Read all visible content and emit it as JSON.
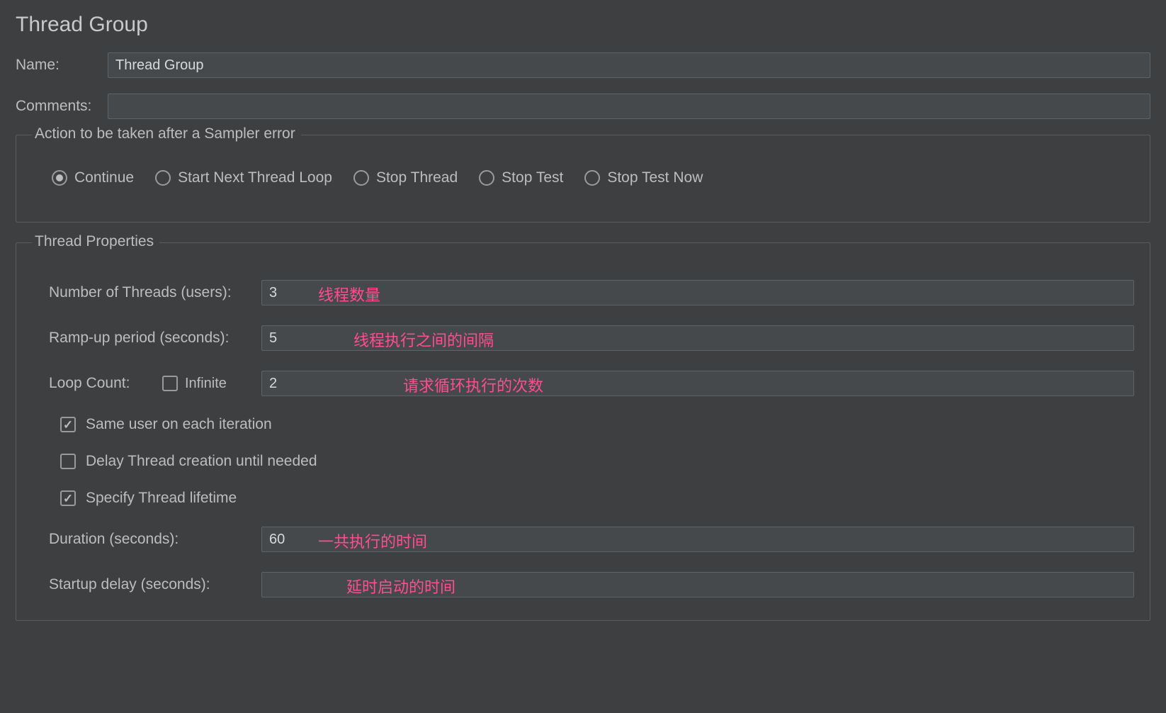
{
  "title": "Thread Group",
  "name_label": "Name:",
  "name_value": "Thread Group",
  "comments_label": "Comments:",
  "comments_value": "",
  "action_group": {
    "legend": "Action to be taken after a Sampler error",
    "options": [
      {
        "label": "Continue",
        "checked": true
      },
      {
        "label": "Start Next Thread Loop",
        "checked": false
      },
      {
        "label": "Stop Thread",
        "checked": false
      },
      {
        "label": "Stop Test",
        "checked": false
      },
      {
        "label": "Stop Test Now",
        "checked": false
      }
    ]
  },
  "thread_props": {
    "legend": "Thread Properties",
    "num_threads_label": "Number of Threads (users):",
    "num_threads_value": "3",
    "ramp_label": "Ramp-up period (seconds):",
    "ramp_value": "5",
    "loop_label": "Loop Count:",
    "infinite_label": "Infinite",
    "infinite_checked": false,
    "loop_value": "2",
    "same_user_label": "Same user on each iteration",
    "same_user_checked": true,
    "delay_thread_label": "Delay Thread creation until needed",
    "delay_thread_checked": false,
    "specify_lifetime_label": "Specify Thread lifetime",
    "specify_lifetime_checked": true,
    "duration_label": "Duration (seconds):",
    "duration_value": "60",
    "startup_delay_label": "Startup delay (seconds):",
    "startup_delay_value": ""
  },
  "annotations": {
    "a1": "线程数量",
    "a2": "线程执行之间的间隔",
    "a3": "请求循环执行的次数",
    "a4": "一共执行的时间",
    "a5": "延时启动的时间"
  }
}
